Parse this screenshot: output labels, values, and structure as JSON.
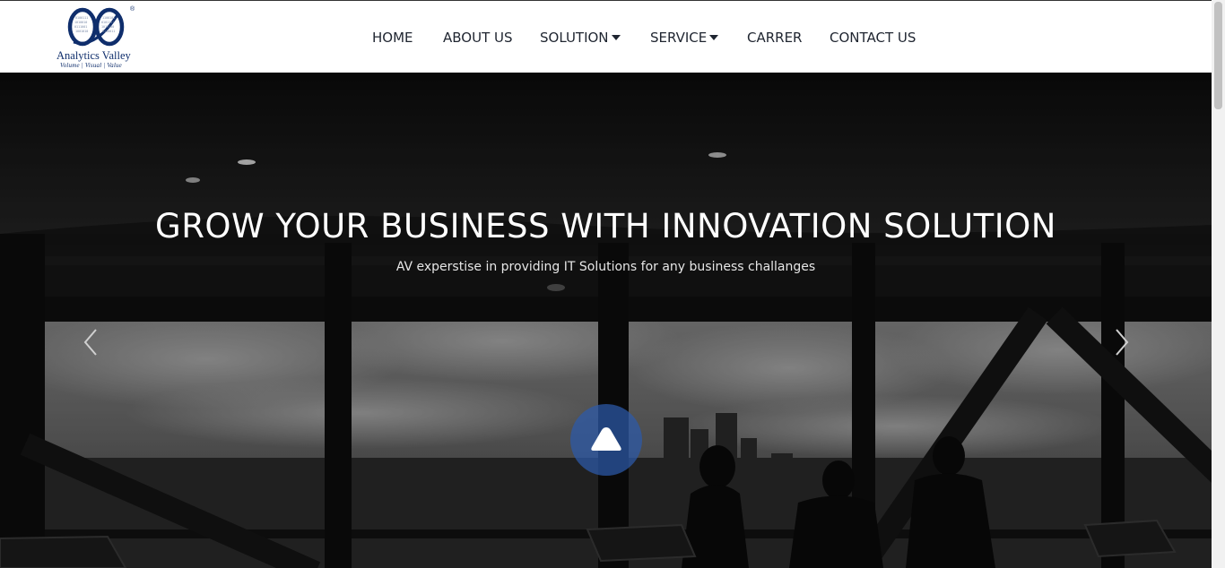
{
  "brand": {
    "name": "Analytics Valley",
    "tagline": "Volume | Visual | Value",
    "registered_mark": "®",
    "color": "#0f2e6c"
  },
  "nav": {
    "items": [
      {
        "label": "HOME"
      },
      {
        "label": "ABOUT US"
      },
      {
        "label": "SOLUTION",
        "dropdown": true
      },
      {
        "label": "SERVICE",
        "dropdown": true
      },
      {
        "label": "CARRER"
      },
      {
        "label": "CONTACT US"
      }
    ]
  },
  "hero": {
    "title": "GROW YOUR BUSINESS WITH INNOVATION SOLUTION",
    "subtitle": "AV experstise in providing IT Solutions for any business challanges",
    "prev_icon": "chevron-left-icon",
    "next_icon": "chevron-right-icon",
    "back_to_top_icon": "triangle-up-icon",
    "back_to_top_color": "#2d5aaa"
  }
}
